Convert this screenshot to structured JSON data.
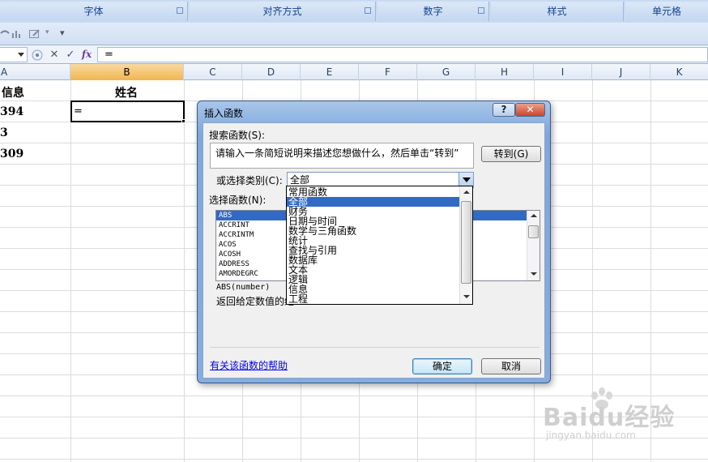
{
  "ribbon": {
    "groups": [
      "字体",
      "对齐方式",
      "数字",
      "样式",
      "单元格"
    ]
  },
  "quick_access": {
    "icons": [
      "undo-icon",
      "chart-icon",
      "edit-icon",
      "customize-icon"
    ],
    "overflow": "▾"
  },
  "formula_bar": {
    "cancel_symbol": "✕",
    "enter_symbol": "✓",
    "fx_symbol": "fx",
    "content": "="
  },
  "columns": [
    "A",
    "B",
    "C",
    "D",
    "E",
    "F",
    "G",
    "H",
    "I",
    "J",
    "K"
  ],
  "selected_column": "B",
  "cells": {
    "a1": "信息",
    "b1": "姓名",
    "a2": "394",
    "a3": "3",
    "a4": "309",
    "b2": "="
  },
  "dialog": {
    "title": "插入函数",
    "help_button": "?",
    "close_button": "✕",
    "search_label": "搜索函数(S):",
    "search_placeholder": "请输入一条简短说明来描述您想做什么，然后单击“转到”",
    "go_button": "转到(G)",
    "category_label": "或选择类别(C):",
    "category_value": "全部",
    "function_label": "选择函数(N):",
    "functions": [
      "ABS",
      "ACCRINT",
      "ACCRINTM",
      "ACOS",
      "ACOSH",
      "ADDRESS",
      "AMORDEGRC"
    ],
    "selected_function": "ABS",
    "syntax": "ABS(number)",
    "description": "返回给定数值的绝",
    "help_link": "有关该函数的帮助",
    "ok_button": "确定",
    "cancel_button": "取消"
  },
  "category_dropdown": {
    "items": [
      "常用函数",
      "全部",
      "财务",
      "日期与时间",
      "数学与三角函数",
      "统计",
      "查找与引用",
      "数据库",
      "文本",
      "逻辑",
      "信息",
      "工程"
    ],
    "selected": "全部"
  },
  "watermark": {
    "brand": "Baidu经验",
    "url": "jingyan.baidu.com"
  }
}
